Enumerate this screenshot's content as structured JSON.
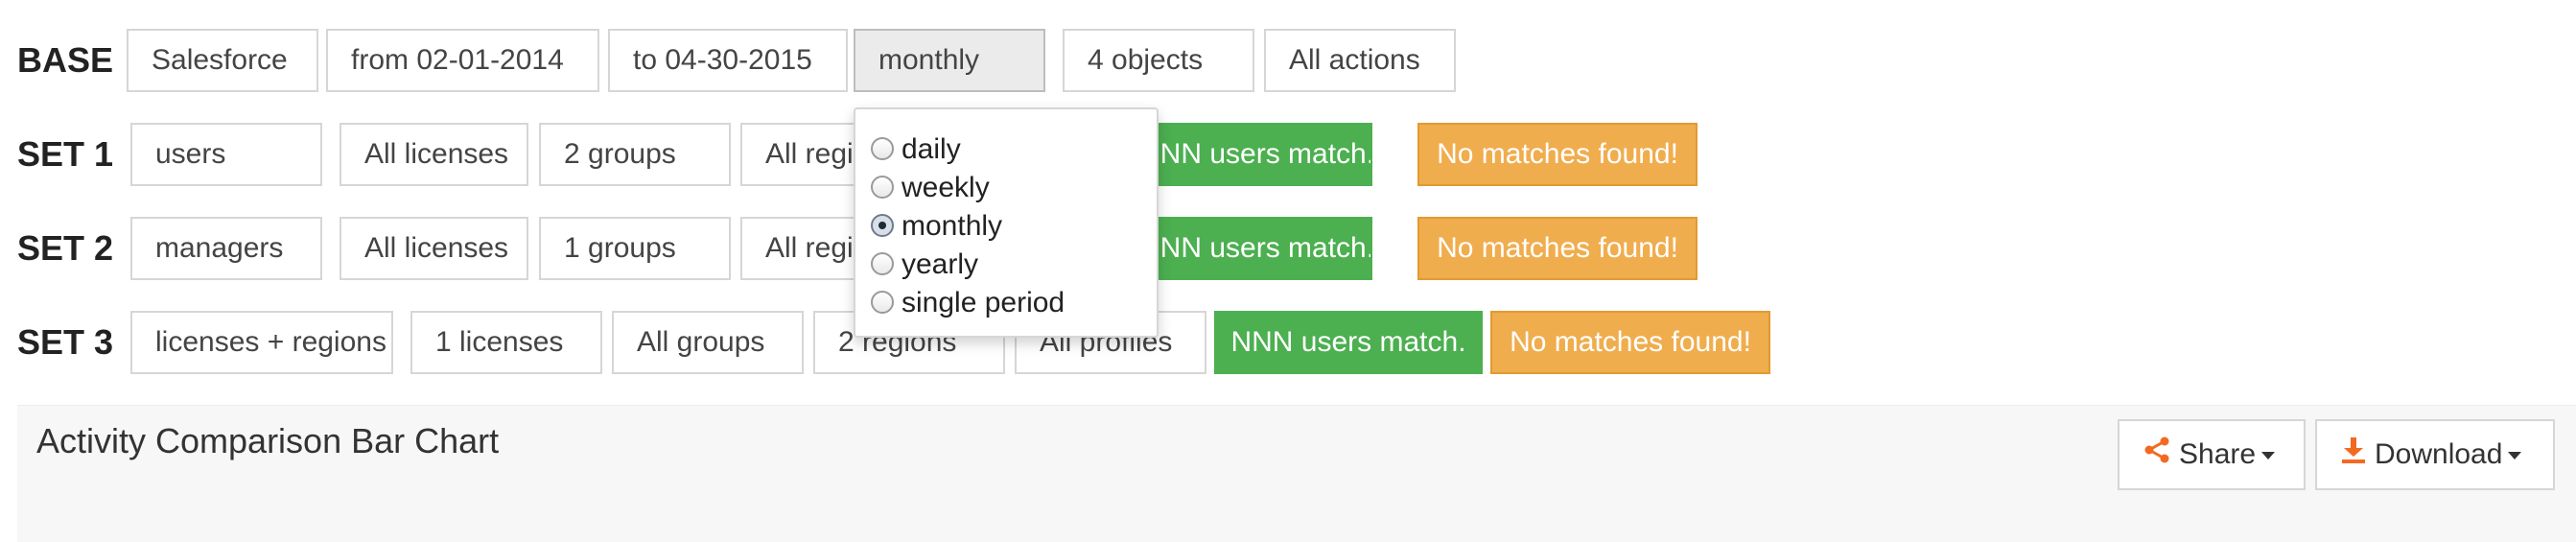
{
  "base": {
    "label": "BASE",
    "fields": [
      "Salesforce",
      "from 02-01-2014",
      "to 04-30-2015",
      "monthly",
      "4 objects",
      "All actions"
    ]
  },
  "sets": [
    {
      "label": "SET 1",
      "fields": [
        "users",
        "All licenses",
        "2 groups",
        "All regions"
      ],
      "match": "NNN users match.",
      "nomatch": "No matches found!"
    },
    {
      "label": "SET 2",
      "fields": [
        "managers",
        "All licenses",
        "1 groups",
        "All regions"
      ],
      "match": "NNN users match.",
      "nomatch": "No matches found!"
    },
    {
      "label": "SET 3",
      "fields": [
        "licenses + regions",
        "1 licenses",
        "All groups",
        "2 regions",
        "All profiles"
      ],
      "match": "NNN users match.",
      "nomatch": "No matches found!"
    }
  ],
  "period_dropdown": {
    "options": [
      "daily",
      "weekly",
      "monthly",
      "yearly",
      "single period"
    ],
    "selected": "monthly"
  },
  "panel": {
    "title": "Activity Comparison Bar Chart",
    "share_label": "Share",
    "download_label": "Download"
  },
  "colors": {
    "match_green": "#4caf50",
    "nomatch_orange": "#f0ad4e",
    "icon_orange": "#f26a21"
  },
  "icons": [
    "share-icon",
    "download-icon",
    "caret-down-icon"
  ]
}
